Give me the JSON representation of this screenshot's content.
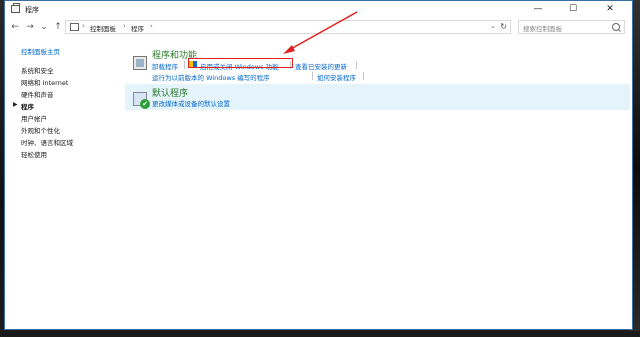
{
  "window": {
    "title": "程序"
  },
  "titlebar": {
    "minimize": "—",
    "maximize": "☐",
    "close": "✕"
  },
  "nav": {
    "back": "←",
    "forward": "→",
    "down": "⌄",
    "up": "↑"
  },
  "address": {
    "crumbs": [
      "控制面板",
      "程序"
    ],
    "separator": "›",
    "dropdown": "⌄",
    "refresh": "↻"
  },
  "search": {
    "placeholder": "搜索控制面板"
  },
  "sidebar": {
    "home": "控制面板主页",
    "items": [
      "系统和安全",
      "网络和 Internet",
      "硬件和声音",
      "程序",
      "用户帐户",
      "外观和个性化",
      "时钟、语言和区域",
      "轻松使用"
    ],
    "current_marker": "▶"
  },
  "sections": {
    "programs_features": {
      "title": "程序和功能",
      "links": [
        "卸载程序",
        "启用或关闭 Windows 功能",
        "查看已安装的更新",
        "运行为以前版本的 Windows 编写的程序",
        "如何安装程序"
      ]
    },
    "default_programs": {
      "title": "默认程序",
      "links": [
        "更改媒体或设备的默认设置"
      ]
    }
  },
  "colors": {
    "link": "#0066cc",
    "section_title": "#2a7a2a",
    "annotation": "#e02020",
    "hover_row": "#e5f3fb"
  }
}
